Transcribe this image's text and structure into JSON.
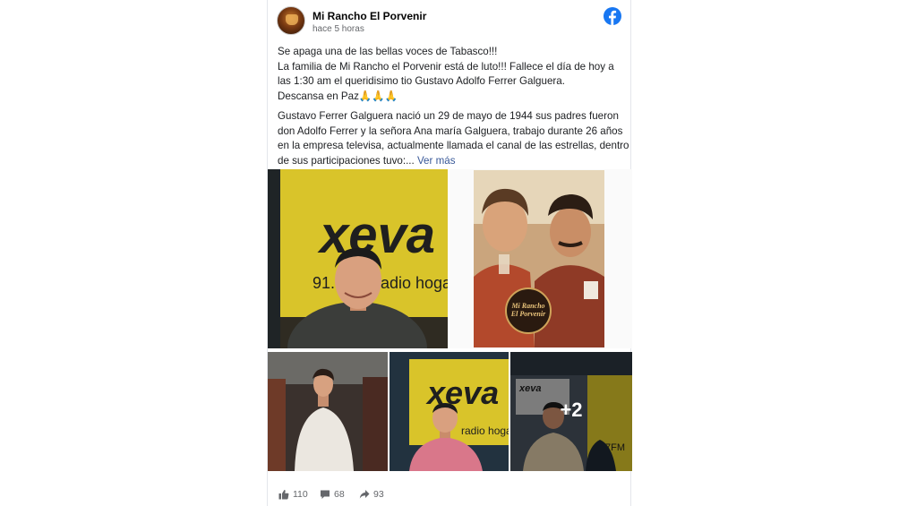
{
  "post": {
    "author": "Mi Rancho El Porvenir",
    "timestamp": "hace 5 horas",
    "lines": [
      "Se apaga una de las bellas voces de Tabasco!!!",
      "La familia de Mi Rancho el Porvenir está de luto!!! Fallece el día de hoy a",
      "las 1:30 am el queridisimo tio Gustavo Adolfo Ferrer Galguera.",
      "Descansa en Paz🙏🙏🙏"
    ],
    "bio_lines": [
      "Gustavo Ferrer Galguera nació un 29 de mayo de 1944 sus padres fueron",
      "don Adolfo Ferrer y la señora Ana maría Galguera, trabajo durante 26 años",
      "en la empresa televisa, actualmente llamada el canal de las estrellas, dentro",
      "de sus participaciones tuvo:..."
    ],
    "see_more": "Ver más",
    "photos": {
      "logo_text_main": "xeva",
      "logo_text_sub": "91.",
      "logo_text_radio": "radio hogar",
      "badge_line1": "Mi Rancho",
      "badge_line2": "El Porvenir",
      "more_count": "+2",
      "small_logo": "xeva",
      "freq_fragment": "7FM"
    },
    "stats": {
      "likes": "110",
      "comments": "68",
      "shares": "93"
    }
  },
  "colors": {
    "facebook_blue": "#1877f2",
    "link": "#385898",
    "muted": "#65676b",
    "xeva_yellow": "#d9c42a"
  }
}
